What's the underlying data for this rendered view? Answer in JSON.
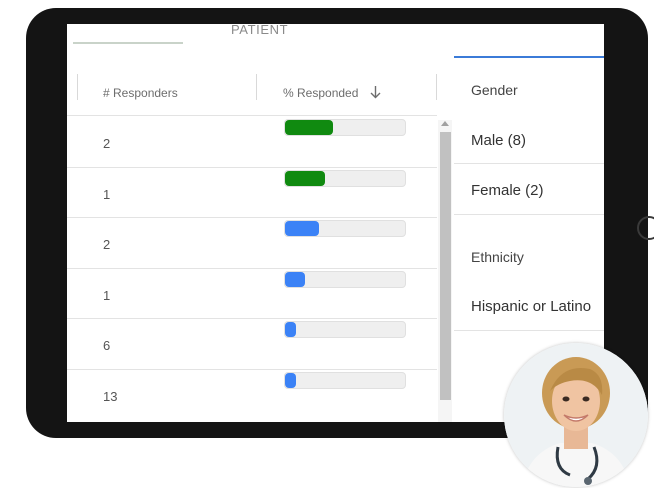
{
  "header": {
    "section_label": "PATIENT"
  },
  "table": {
    "col_responders": "# Responders",
    "col_responded": "% Responded",
    "sort_icon": "arrow-down-icon",
    "rows": [
      {
        "responders": "2",
        "responded_fraction": 0.4,
        "color": "#108a10"
      },
      {
        "responders": "1",
        "responded_fraction": 0.33,
        "color": "#108a10"
      },
      {
        "responders": "2",
        "responded_fraction": 0.28,
        "color": "#3b82f6"
      },
      {
        "responders": "1",
        "responded_fraction": 0.17,
        "color": "#3b82f6"
      },
      {
        "responders": "6",
        "responded_fraction": 0.09,
        "color": "#3b82f6"
      },
      {
        "responders": "13",
        "responded_fraction": 0.09,
        "color": "#3b82f6"
      }
    ]
  },
  "filters": {
    "gender_heading": "Gender",
    "gender_options": [
      "Male (8)",
      "Female (2)"
    ],
    "ethnicity_heading": "Ethnicity",
    "ethnicity_options": [
      "Hispanic or Latino"
    ]
  },
  "avatar": {
    "icon": "doctor-avatar"
  },
  "colors": {
    "green_bar": "#108a10",
    "blue_bar": "#3b82f6",
    "accent": "#3b7bd8"
  }
}
